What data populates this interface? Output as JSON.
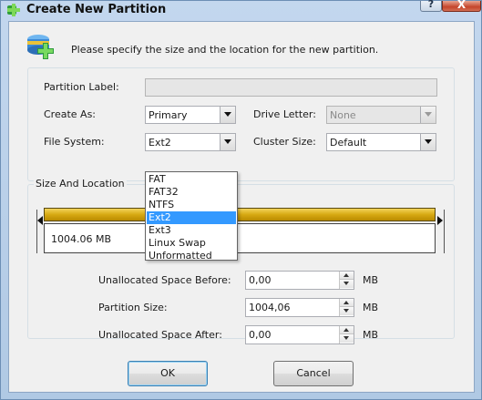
{
  "window": {
    "title": "Create New Partition",
    "help_glyph": "?",
    "close_glyph": "X"
  },
  "header": {
    "description": "Please specify the size and the location for the new partition."
  },
  "settings": {
    "partition_label": {
      "label": "Partition Label:",
      "value": ""
    },
    "create_as": {
      "label": "Create As:",
      "value": "Primary"
    },
    "drive_letter": {
      "label": "Drive Letter:",
      "value": "None"
    },
    "file_system": {
      "label": "File System:",
      "value": "Ext2"
    },
    "cluster_size": {
      "label": "Cluster Size:",
      "value": "Default"
    }
  },
  "file_system_options": [
    "FAT",
    "FAT32",
    "NTFS",
    "Ext2",
    "Ext3",
    "Linux Swap",
    "Unformatted"
  ],
  "file_system_selected": "Ext2",
  "size_location": {
    "title": "Size And Location",
    "bar_label": "1004.06 MB",
    "unalloc_before": {
      "label": "Unallocated Space Before:",
      "value": "0,00",
      "unit": "MB"
    },
    "partition_size": {
      "label": "Partition Size:",
      "value": "1004,06",
      "unit": "MB"
    },
    "unalloc_after": {
      "label": "Unallocated Space After:",
      "value": "0,00",
      "unit": "MB"
    }
  },
  "buttons": {
    "ok": "OK",
    "cancel": "Cancel"
  },
  "colors": {
    "bar_fill": "#d7a912",
    "selection": "#3399ff",
    "close_button": "#c5452a"
  }
}
